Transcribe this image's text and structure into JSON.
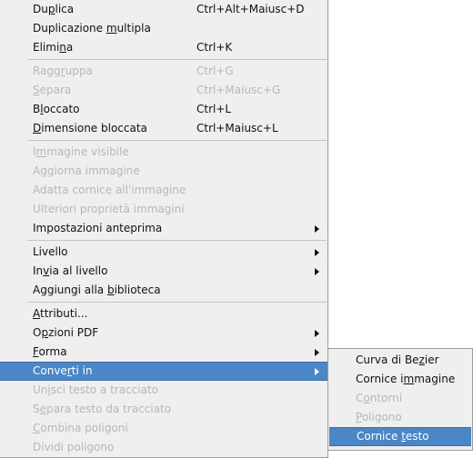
{
  "menu": {
    "items": [
      {
        "pre": "Du",
        "acc": "p",
        "post": "lica",
        "shortcut": "Ctrl+Alt+Maiusc+D",
        "disabled": false
      },
      {
        "pre": "Duplicazione ",
        "acc": "m",
        "post": "ultipla",
        "shortcut": "",
        "disabled": false
      },
      {
        "pre": "Elimi",
        "acc": "n",
        "post": "a",
        "shortcut": "Ctrl+K",
        "disabled": false
      },
      {
        "pre": "Ragg",
        "acc": "r",
        "post": "uppa",
        "shortcut": "Ctrl+G",
        "disabled": true
      },
      {
        "pre": "",
        "acc": "S",
        "post": "epara",
        "shortcut": "Ctrl+Maiusc+G",
        "disabled": true
      },
      {
        "pre": "B",
        "acc": "l",
        "post": "occato",
        "shortcut": "Ctrl+L",
        "disabled": false
      },
      {
        "pre": "",
        "acc": "D",
        "post": "imensione bloccata",
        "shortcut": "Ctrl+Maiusc+L",
        "disabled": false
      },
      {
        "pre": "I",
        "acc": "m",
        "post": "magine visibile",
        "shortcut": "",
        "disabled": true
      },
      {
        "pre": "A",
        "acc": "g",
        "post": "giorna immagine",
        "shortcut": "",
        "disabled": true
      },
      {
        "pre": "Adatta cornice all'immagine",
        "acc": "",
        "post": "",
        "shortcut": "",
        "disabled": true
      },
      {
        "pre": "Ulteriori proprietà immagini",
        "acc": "",
        "post": "",
        "shortcut": "",
        "disabled": true
      },
      {
        "pre": "Impostazioni anteprima",
        "acc": "",
        "post": "",
        "shortcut": "",
        "disabled": false
      },
      {
        "pre": "Livello",
        "acc": "",
        "post": "",
        "shortcut": "",
        "disabled": false
      },
      {
        "pre": "In",
        "acc": "v",
        "post": "ia al livello",
        "shortcut": "",
        "disabled": false
      },
      {
        "pre": "Aggiungi alla ",
        "acc": "b",
        "post": "iblioteca",
        "shortcut": "",
        "disabled": false
      },
      {
        "pre": "",
        "acc": "A",
        "post": "ttributi...",
        "shortcut": "",
        "disabled": false
      },
      {
        "pre": "O",
        "acc": "p",
        "post": "zioni PDF",
        "shortcut": "",
        "disabled": false
      },
      {
        "pre": "",
        "acc": "F",
        "post": "orma",
        "shortcut": "",
        "disabled": false
      },
      {
        "pre": "Conve",
        "acc": "r",
        "post": "ti in",
        "shortcut": "",
        "disabled": false
      },
      {
        "pre": "Un",
        "acc": "i",
        "post": "sci testo a tracciato",
        "shortcut": "",
        "disabled": true
      },
      {
        "pre": "S",
        "acc": "e",
        "post": "para testo da tracciato",
        "shortcut": "",
        "disabled": true
      },
      {
        "pre": "",
        "acc": "C",
        "post": "ombina poligoni",
        "shortcut": "",
        "disabled": true
      },
      {
        "pre": "Dividi poligono",
        "acc": "",
        "post": "",
        "shortcut": "",
        "disabled": true
      }
    ]
  },
  "submenu": {
    "items": [
      {
        "pre": "Curva di Be",
        "acc": "z",
        "post": "ier",
        "disabled": false
      },
      {
        "pre": "Cornice i",
        "acc": "m",
        "post": "magine",
        "disabled": false
      },
      {
        "pre": "C",
        "acc": "o",
        "post": "ntorni",
        "disabled": true
      },
      {
        "pre": "",
        "acc": "P",
        "post": "oligono",
        "disabled": true
      },
      {
        "pre": "Cornice ",
        "acc": "t",
        "post": "esto",
        "disabled": false
      }
    ]
  },
  "colors": {
    "highlight": "#4b86c7",
    "menu_bg": "#efefef",
    "disabled_text": "#b7b7b7"
  },
  "icons": {
    "submenu_arrow": "submenu-arrow-icon"
  }
}
